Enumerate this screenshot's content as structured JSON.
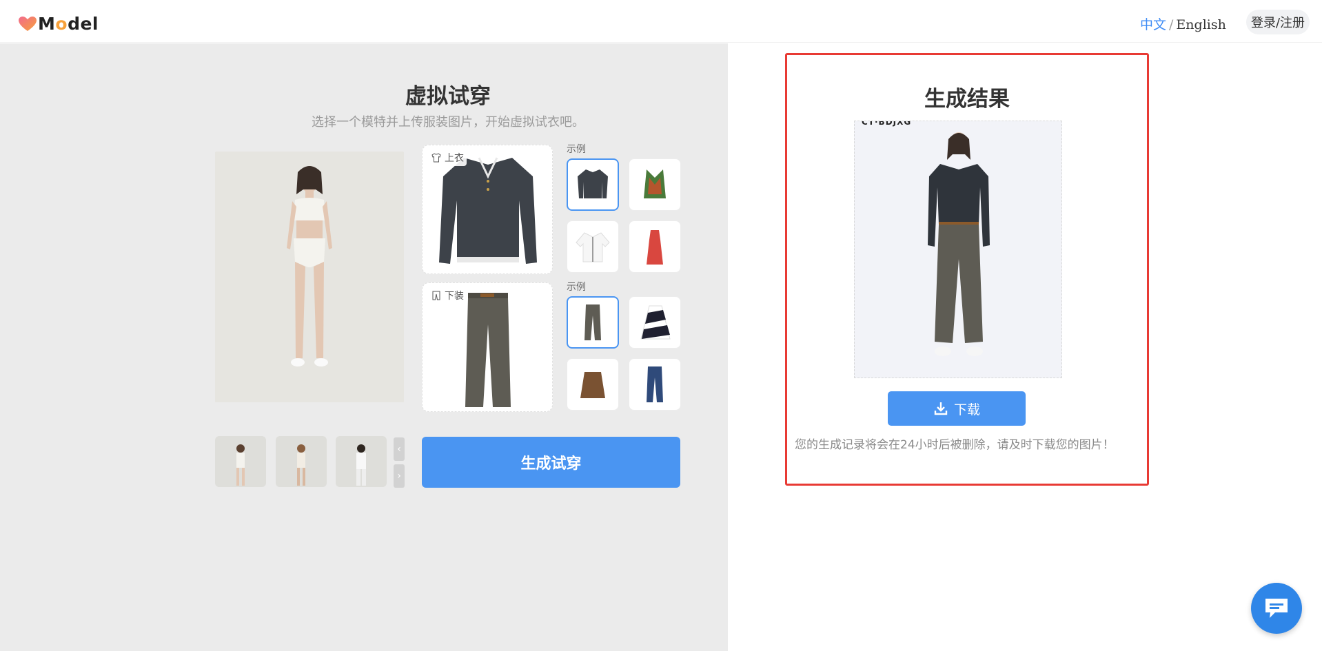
{
  "header": {
    "logo_text": "Model",
    "lang_zh": "中文",
    "lang_sep": "/",
    "lang_en": "English",
    "login_label": "登录/注册"
  },
  "left": {
    "title": "虚拟试穿",
    "subtitle": "选择一个模特并上传服装图片，开始虚拟试衣吧。",
    "top_slot_label": "上衣",
    "bottom_slot_label": "下装",
    "example_label_1": "示例",
    "example_label_2": "示例",
    "generate_label": "生成试穿",
    "arrow_prev": "‹",
    "arrow_next": "›"
  },
  "result": {
    "title": "生成结果",
    "image_caption": "CT·BDJXG",
    "download_label": "下载",
    "note": "您的生成记录将会在24小时后被删除，请及时下载您的图片！"
  },
  "colors": {
    "accent": "#4a95f2",
    "highlight_border": "#e83a34",
    "panel_bg": "#ebebeb",
    "logo_heart_pink": "#f26a8d",
    "logo_heart_orange": "#f7a13b"
  },
  "icons": {
    "top_slot": "shirt-icon",
    "bottom_slot": "pants-icon",
    "download": "download-icon",
    "chat": "chat-bubble-icon"
  }
}
